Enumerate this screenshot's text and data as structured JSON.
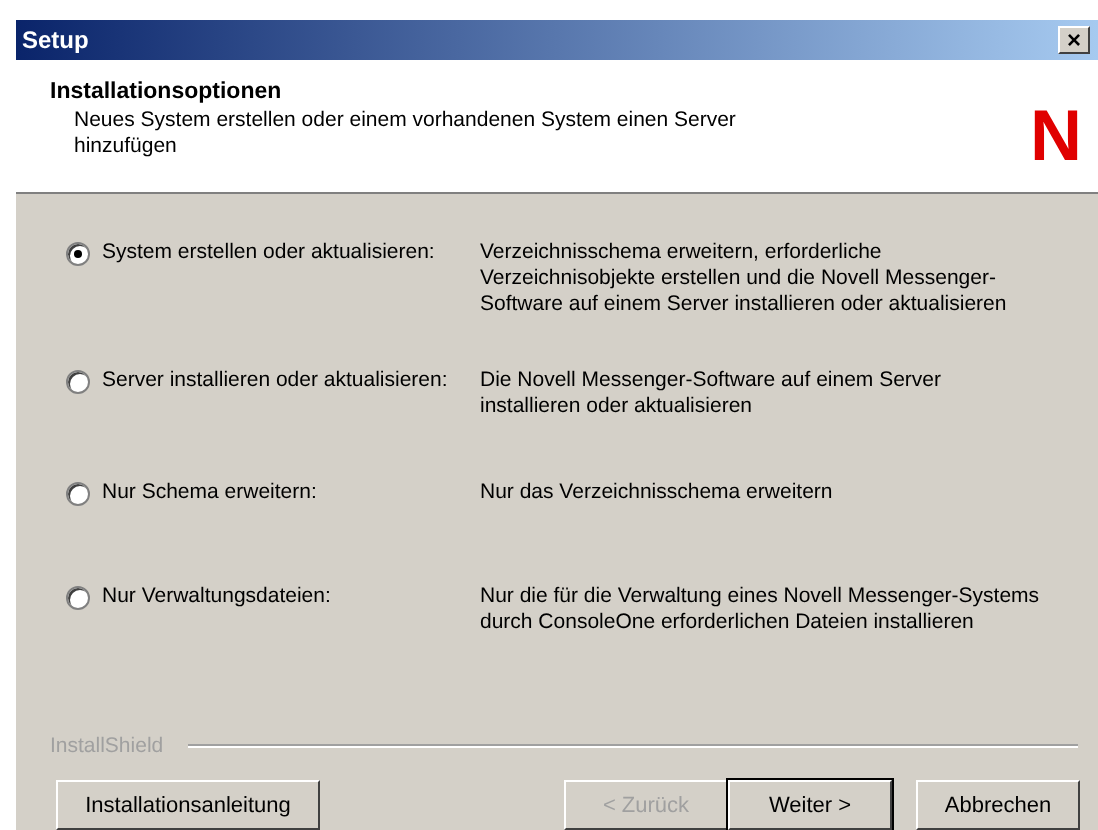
{
  "window": {
    "title": "Setup",
    "close": "×"
  },
  "header": {
    "title": "Installationsoptionen",
    "subtitle": "Neues System erstellen oder einem vorhandenen System einen Server hinzufügen",
    "logo": "N"
  },
  "options": [
    {
      "label": "System erstellen oder aktualisieren:",
      "description": "Verzeichnisschema erweitern, erforderliche Verzeichnisobjekte erstellen und die Novell Messenger-Software auf einem Server installieren oder aktualisieren",
      "selected": true
    },
    {
      "label": "Server installieren oder aktualisieren:",
      "description": "Die Novell Messenger-Software auf einem Server installieren oder aktualisieren",
      "selected": false
    },
    {
      "label": "Nur Schema erweitern:",
      "description": "Nur das Verzeichnisschema erweitern",
      "selected": false
    },
    {
      "label": "Nur Verwaltungsdateien:",
      "description": "Nur die für die Verwaltung eines Novell Messenger-Systems durch ConsoleOne erforderlichen Dateien installieren",
      "selected": false
    }
  ],
  "footer": {
    "brand": "InstallShield"
  },
  "buttons": [
    {
      "label": "Installationsanleitung",
      "kind": "left",
      "disabled": false,
      "default": false
    },
    {
      "label": "< Zurück",
      "kind": "right",
      "disabled": true,
      "default": false
    },
    {
      "label": "Weiter >",
      "kind": "right",
      "disabled": false,
      "default": true
    },
    {
      "label": "Abbrechen",
      "kind": "cancel",
      "disabled": false,
      "default": false
    }
  ]
}
